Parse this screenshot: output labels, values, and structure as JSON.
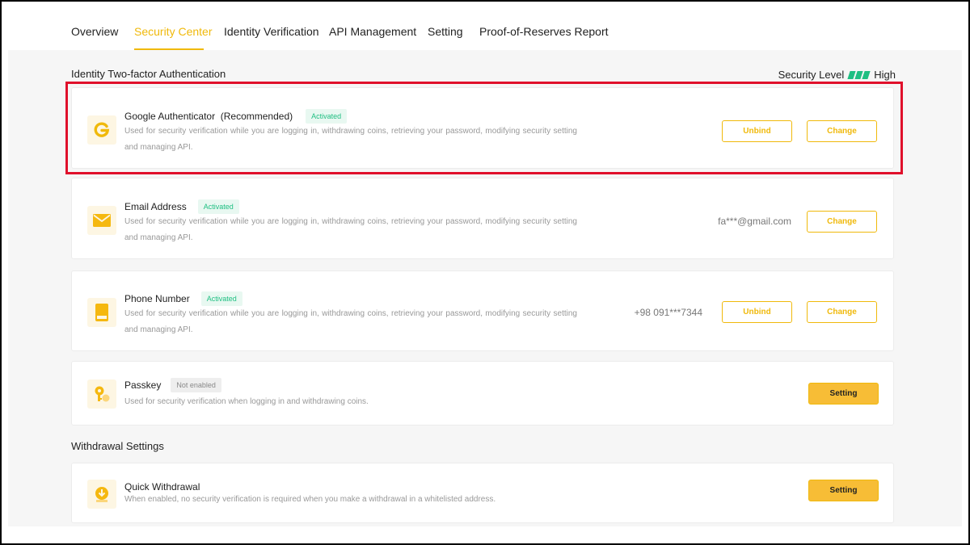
{
  "nav": {
    "tabs": [
      {
        "label": "Overview"
      },
      {
        "label": "Security Center"
      },
      {
        "label": "Identity Verification"
      },
      {
        "label": "API Management"
      },
      {
        "label": "Setting"
      },
      {
        "label": "Proof-of-Reserves Report"
      }
    ],
    "active_index": 1
  },
  "two_factor": {
    "section_title": "Identity Two-factor Authentication",
    "security_level_label": "Security Level",
    "security_level_value": "High",
    "items": [
      {
        "title": "Google Authenticator",
        "title_suffix": "(Recommended)",
        "status": "Activated",
        "description": "Used for security verification while you are logging in, withdrawing coins, retrieving your password, modifying security setting and managing API.",
        "unbind_label": "Unbind",
        "change_label": "Change",
        "icon": "google-authenticator-icon"
      },
      {
        "title": "Email Address",
        "status": "Activated",
        "description": "Used for security verification while you are logging in, withdrawing coins, retrieving your password, modifying security setting and managing API.",
        "value": "fa***@gmail.com",
        "change_label": "Change",
        "icon": "envelope-icon"
      },
      {
        "title": "Phone Number",
        "status": "Activated",
        "description": "Used for security verification while you are logging in, withdrawing coins, retrieving your password, modifying security setting and managing API.",
        "value": "+98 091***7344",
        "unbind_label": "Unbind",
        "change_label": "Change",
        "icon": "phone-icon"
      },
      {
        "title": "Passkey",
        "status": "Not enabled",
        "description": "Used for security verification when logging in and withdrawing coins.",
        "setting_label": "Setting",
        "icon": "key-icon"
      }
    ]
  },
  "withdrawal": {
    "section_title": "Withdrawal Settings",
    "items": [
      {
        "title": "Quick Withdrawal",
        "description": "When enabled, no security verification is required when you make a withdrawal in a whitelisted address.",
        "setting_label": "Setting",
        "icon": "quick-withdrawal-icon"
      }
    ]
  },
  "colors": {
    "accent": "#f0b90b",
    "success": "#1fbf82",
    "highlight": "#e0102b"
  }
}
